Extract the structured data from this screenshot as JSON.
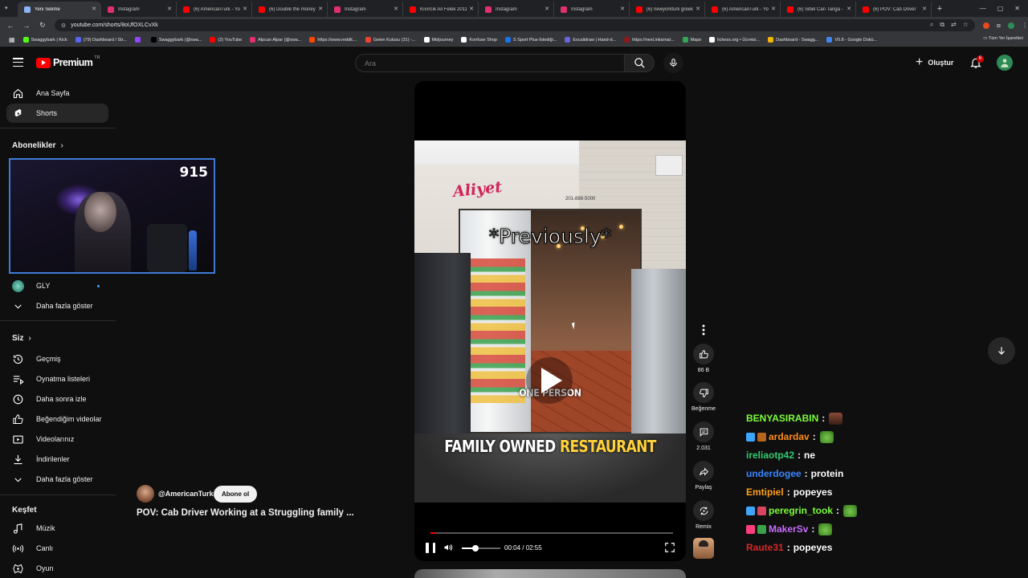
{
  "browser": {
    "tabs": [
      {
        "title": "Yeni Sekme",
        "color": "#8ab4f8"
      },
      {
        "title": "Instagram",
        "color": "#e1306c"
      },
      {
        "title": "(6) AmericanTurk - Yo",
        "color": "#ff0000"
      },
      {
        "title": "(6) Double the money",
        "color": "#ff0000"
      },
      {
        "title": "Instagram",
        "color": "#e1306c"
      },
      {
        "title": "Kıvırcık Ali Felek 2011",
        "color": "#ff0000"
      },
      {
        "title": "Instagram",
        "color": "#e1306c"
      },
      {
        "title": "Instagram",
        "color": "#e1306c"
      },
      {
        "title": "(6) newyorkturk greek",
        "color": "#ff0000"
      },
      {
        "title": "(6) AmericanTurk - Yo",
        "color": "#ff0000"
      },
      {
        "title": "(6) Sibel Can Tanga - V",
        "color": "#ff0000"
      },
      {
        "title": "(6) POV: Cab Driver",
        "color": "#ff0000"
      }
    ],
    "new_tab_label": "+",
    "url": "youtube.com/shorts/8oUfOXLCvXk",
    "bookmarks": [
      {
        "label": "Swaggybark | Kick",
        "color": "#53fc18"
      },
      {
        "label": "(79) Dashboard / Str...",
        "color": "#5865f2"
      },
      {
        "label": "",
        "color": "#9146ff"
      },
      {
        "label": "Swaggybark (@swa...",
        "color": "#000000"
      },
      {
        "label": "(2) YouTube",
        "color": "#ff0000"
      },
      {
        "label": "Alpcan Alpar (@swa...",
        "color": "#e1306c"
      },
      {
        "label": "https://www.reddit....",
        "color": "#ff4500"
      },
      {
        "label": "Gelen Kutusu (31) -...",
        "color": "#ea4335"
      },
      {
        "label": "Midjourney",
        "color": "#ffffff"
      },
      {
        "label": "Konfuse Shop",
        "color": "#ffffff"
      },
      {
        "label": "S Sport Plus-İstediği...",
        "color": "#1a73e8"
      },
      {
        "label": "Excalidraw | Hand-d...",
        "color": "#6965db"
      },
      {
        "label": "https://next.inkarnat...",
        "color": "#8b1a1a"
      },
      {
        "label": "Maps",
        "color": "#34a853"
      },
      {
        "label": "lichess.org • Ücretsi...",
        "color": "#ffffff"
      },
      {
        "label": "Dashboard - Swagg...",
        "color": "#f4b400"
      },
      {
        "label": "V0.8 - Google Dokü...",
        "color": "#4285f4"
      }
    ],
    "all_bookmarks_label": "Tüm Yer İşaretleri"
  },
  "header": {
    "logo_text": "Premium",
    "logo_region": "TR",
    "search_placeholder": "Ara",
    "create_label": "Oluştur",
    "notification_count": "6"
  },
  "sidebar": {
    "main": [
      {
        "label": "Ana Sayfa",
        "icon": "home-icon"
      },
      {
        "label": "Shorts",
        "icon": "shorts-icon",
        "active": true
      }
    ],
    "subscriptions_title": "Abonelikler",
    "subscriptions": [
      {
        "label": "GLY",
        "live": true
      }
    ],
    "show_more_subs": "Daha fazla göster",
    "you_title": "Siz",
    "you_items": [
      {
        "label": "Geçmiş",
        "icon": "history-icon"
      },
      {
        "label": "Oynatma listeleri",
        "icon": "playlist-icon"
      },
      {
        "label": "Daha sonra izle",
        "icon": "clock-icon"
      },
      {
        "label": "Beğendiğim videolar",
        "icon": "like-icon"
      },
      {
        "label": "Videolarınız",
        "icon": "video-icon"
      },
      {
        "label": "İndirilenler",
        "icon": "download-icon"
      },
      {
        "label": "Daha fazla göster",
        "icon": "chevron-down-icon"
      }
    ],
    "explore_title": "Keşfet",
    "explore_items": [
      {
        "label": "Müzik",
        "icon": "music-icon"
      },
      {
        "label": "Canlı",
        "icon": "live-icon"
      },
      {
        "label": "Oyun",
        "icon": "gaming-icon"
      }
    ]
  },
  "webcam": {
    "viewer_count": "915"
  },
  "video": {
    "overlay_sign": "Aliyet",
    "overlay_phone": "201-888-5000",
    "caption_top": "*Previously*",
    "caption_mid": "ONE PERSON",
    "caption_bottom_1": "FAMILY OWNED",
    "caption_bottom_2": "RESTAURANT",
    "time": "00:04 / 02:55",
    "progress": 0.023,
    "volume": 0.35
  },
  "actions": {
    "likes": "86 B",
    "dislike_label": "Beğenme",
    "comments": "2.031",
    "share_label": "Paylaş",
    "remix_label": "Remix"
  },
  "channel": {
    "handle": "@AmericanTurk",
    "subscribe_label": "Abone ol",
    "title": "POV: Cab Driver Working at a Struggling family ..."
  },
  "chat": [
    {
      "user": "BENYASIRABIN",
      "color": "#7cfc3a",
      "msg": "",
      "emote": "brown",
      "badges": []
    },
    {
      "user": "ardardav",
      "color": "#ff8c1a",
      "msg": "",
      "emote": "frog",
      "badges": [
        "#3ea6ff",
        "#b5651d"
      ]
    },
    {
      "user": "ireliaotp42",
      "color": "#2ecc71",
      "msg": "ne",
      "emote": "",
      "badges": []
    },
    {
      "user": "underdogee",
      "color": "#3a86ff",
      "msg": "protein",
      "emote": "",
      "badges": []
    },
    {
      "user": "Emtipiel",
      "color": "#ff9f1a",
      "msg": "popeyes",
      "emote": "",
      "badges": []
    },
    {
      "user": "peregrin_took",
      "color": "#7cfc3a",
      "msg": "",
      "emote": "frog",
      "badges": [
        "#3ea6ff",
        "#d6455d"
      ]
    },
    {
      "user": "MakerSv",
      "color": "#c86bff",
      "msg": "",
      "emote": "frog",
      "badges": [
        "#ff3d7f",
        "#3aa04a"
      ]
    },
    {
      "user": "Raute31",
      "color": "#d62828",
      "msg": "popeyes",
      "emote": "",
      "badges": []
    }
  ]
}
